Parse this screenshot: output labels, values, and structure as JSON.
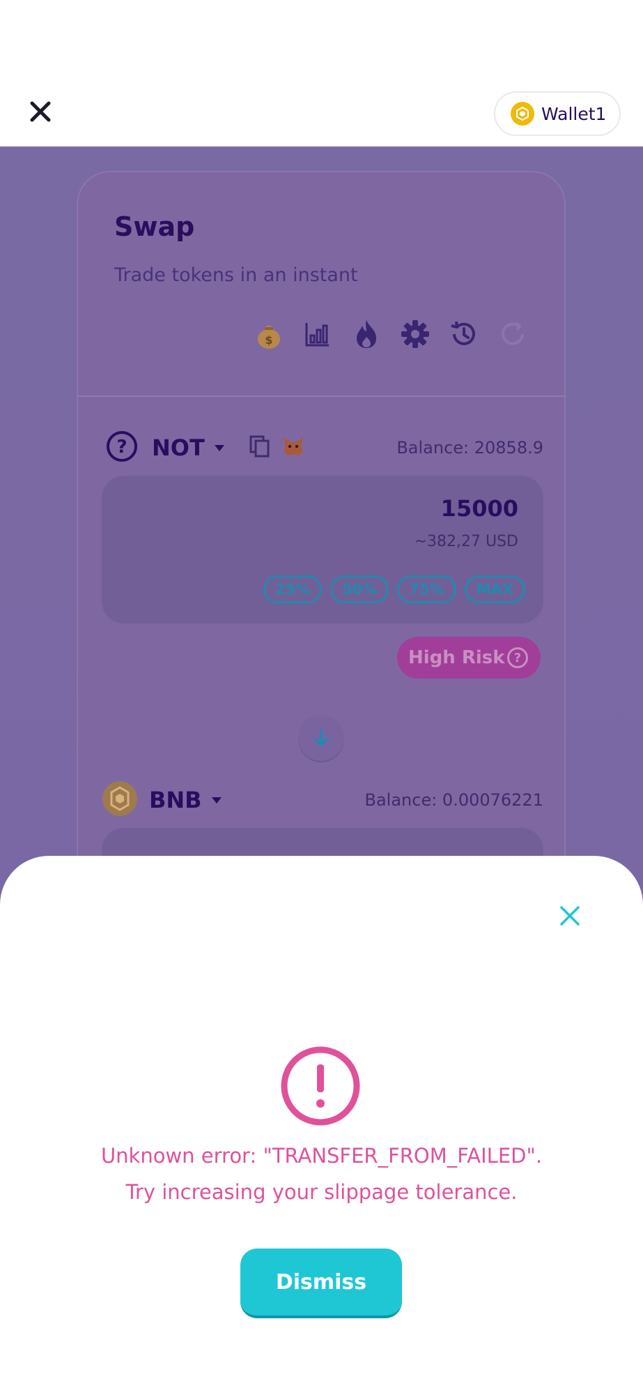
{
  "header": {
    "wallet_label": "Wallet1"
  },
  "swap": {
    "title": "Swap",
    "subtitle": "Trade tokens in an instant",
    "tools": [
      "money-bag-icon",
      "chart-icon",
      "fire-icon",
      "gear-icon",
      "history-icon",
      "refresh-icon"
    ],
    "from_token": {
      "symbol": "NOT",
      "balance": "Balance: 20858.9",
      "amount": "15000",
      "usd": "~382,27 USD",
      "percent_buttons": [
        "25%",
        "50%",
        "75%",
        "MAX"
      ]
    },
    "risk_label": "High Risk",
    "to_token": {
      "symbol": "BNB",
      "balance": "Balance: 0.00076221"
    }
  },
  "modal": {
    "error_line1": "Unknown error: \"TRANSFER_FROM_FAILED\".",
    "error_line2": "Try increasing your slippage tolerance.",
    "dismiss_label": "Dismiss"
  },
  "colors": {
    "accent": "#1fc7d4",
    "error": "#e0519a",
    "overlay": "#7a6aa3",
    "text_dark": "#280d5f"
  }
}
